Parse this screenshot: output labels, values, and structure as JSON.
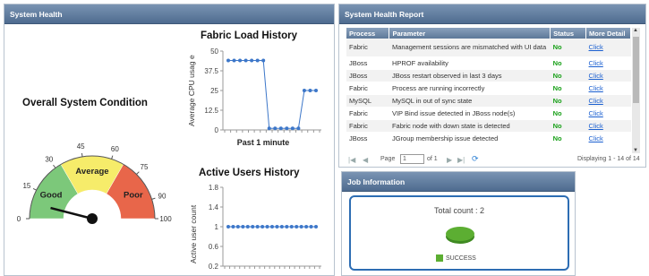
{
  "health": {
    "header": "System Health",
    "gauge": {
      "title": "Overall System Condition",
      "ticks": [
        "0",
        "15",
        "30",
        "45",
        "60",
        "75",
        "90",
        "100"
      ],
      "bands": [
        "Good",
        "Average",
        "Poor"
      ],
      "value": 8,
      "colors": {
        "good": "#7cc87a",
        "average": "#f6ec6a",
        "poor": "#e8664a"
      }
    }
  },
  "chart_data": [
    {
      "type": "line",
      "title": "Fabric Load History",
      "xlabel": "Past 1 minute",
      "ylabel": "Average CPU usag e",
      "ylim": [
        0,
        50
      ],
      "yticks": [
        "0",
        "12.5",
        "25",
        "37.5",
        "50"
      ],
      "values": [
        44,
        44,
        44,
        44,
        44,
        44,
        44,
        1,
        1,
        1,
        1,
        1,
        1,
        25,
        25,
        25
      ],
      "color": "#3d77c9"
    },
    {
      "type": "line",
      "title": "Active Users History",
      "xlabel": "Past 1 minute",
      "ylabel": "Active user count",
      "ylim": [
        0.2,
        1.8
      ],
      "yticks": [
        "0.2",
        "0.6",
        "1",
        "1.4",
        "1.8"
      ],
      "values": [
        1,
        1,
        1,
        1,
        1,
        1,
        1,
        1,
        1,
        1,
        1,
        1,
        1,
        1,
        1,
        1,
        1,
        1,
        1
      ],
      "color": "#3d77c9"
    }
  ],
  "report": {
    "header": "System Health Report",
    "columns": [
      "Process",
      "Parameter",
      "Status",
      "More Detail"
    ],
    "rows": [
      {
        "process": "Fabric",
        "parameter": "Management sessions are mismatched with UI data",
        "status": "No",
        "detail": "Click"
      },
      {
        "process": "JBoss",
        "parameter": "HPROF availability",
        "status": "No",
        "detail": "Click"
      },
      {
        "process": "JBoss",
        "parameter": "JBoss restart observed in last 3 days",
        "status": "No",
        "detail": "Click"
      },
      {
        "process": "Fabric",
        "parameter": "Process are running incorrectly",
        "status": "No",
        "detail": "Click"
      },
      {
        "process": "MySQL",
        "parameter": "MySQL in out of sync state",
        "status": "No",
        "detail": "Click"
      },
      {
        "process": "Fabric",
        "parameter": "VIP Bind issue detected in JBoss node(s)",
        "status": "No",
        "detail": "Click"
      },
      {
        "process": "Fabric",
        "parameter": "Fabric node with down state is detected",
        "status": "No",
        "detail": "Click"
      },
      {
        "process": "JBoss",
        "parameter": "JGroup membership issue detected",
        "status": "No",
        "detail": "Click"
      }
    ],
    "pager": {
      "page_label": "Page",
      "page_value": "1",
      "of_label": "of 1",
      "displaying": "Displaying 1 - 14 of 14"
    }
  },
  "job": {
    "header": "Job Information",
    "total": "Total count : 2",
    "legend": "SUCCESS",
    "color": "#5cae32"
  }
}
